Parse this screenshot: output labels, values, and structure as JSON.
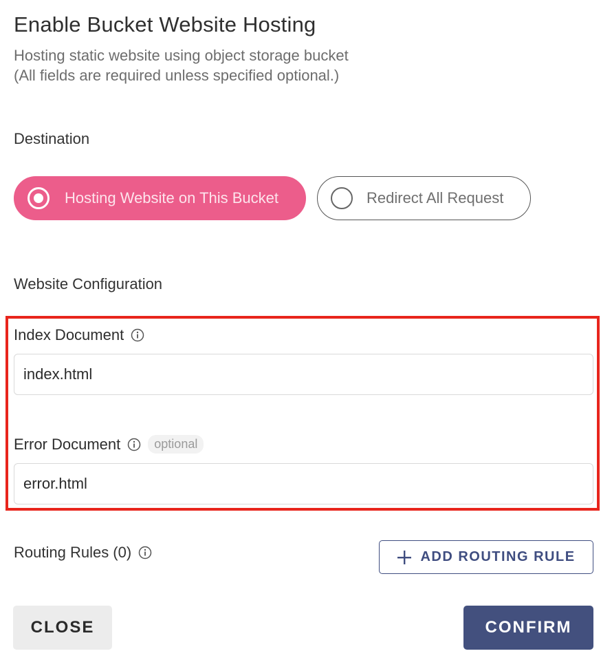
{
  "dialog": {
    "title": "Enable Bucket Website Hosting",
    "subtitle_line1": "Hosting static website using object storage bucket",
    "subtitle_line2": "(All fields are required unless specified optional.)"
  },
  "destination": {
    "label": "Destination",
    "options": [
      {
        "label": "Hosting Website on This Bucket",
        "selected": true
      },
      {
        "label": "Redirect All Request",
        "selected": false
      }
    ]
  },
  "website_configuration": {
    "label": "Website Configuration",
    "index_document": {
      "label": "Index Document",
      "value": "index.html",
      "icon": "info-icon"
    },
    "error_document": {
      "label": "Error Document",
      "badge": "optional",
      "value": "error.html",
      "icon": "info-icon"
    }
  },
  "routing_rules": {
    "label": "Routing Rules (0)",
    "add_button_label": "ADD ROUTING RULE"
  },
  "footer": {
    "close_label": "CLOSE",
    "confirm_label": "CONFIRM"
  },
  "colors": {
    "accent_pink": "#ec5d8b",
    "primary_navy": "#43507e",
    "highlight_red": "#e8251c"
  }
}
